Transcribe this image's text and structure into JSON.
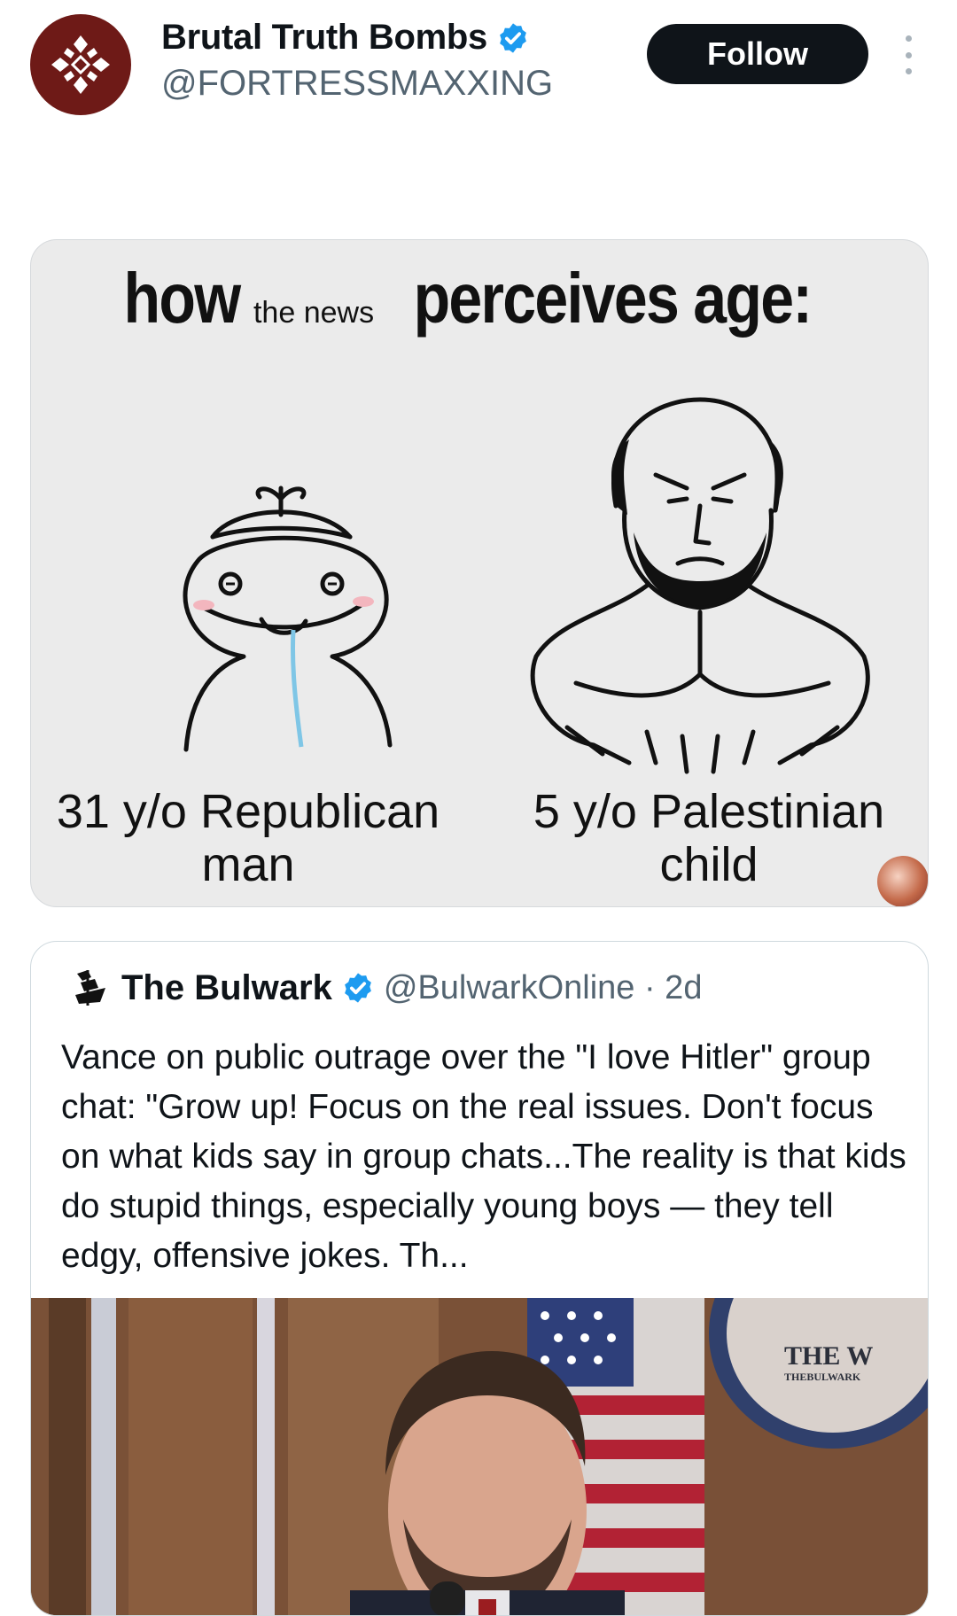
{
  "header": {
    "display_name": "Brutal Truth Bombs",
    "handle": "@FORTRESSMAXXING",
    "follow_label": "Follow"
  },
  "meme": {
    "title_how": "how",
    "title_the_news": "the news",
    "title_perceives": "perceives age:",
    "caption_left": "31 y/o Republican man",
    "caption_right": "5 y/o Palestinian child"
  },
  "quoted_post": {
    "author_name": "The Bulwark",
    "author_handle": "@BulwarkOnline · 2d",
    "text": "Vance on public outrage over the \"I love Hitler\" group chat: \"Grow up! Focus on the real issues. Don't focus on what kids say in group chats...The reality is that kids do stupid things, especially young boys — they tell edgy, offensive jokes. Th...",
    "media_watermark_line1": "THE W",
    "media_watermark_line2": "THEBULWARK"
  },
  "colors": {
    "avatar_bg": "#6e1a17",
    "verified_blue": "#1d9bf0",
    "follow_bg": "#0f1419",
    "muted_text": "#536471"
  },
  "icons": [
    "org-logo-icon",
    "verified-badge-icon",
    "more-options-icon",
    "bulwark-ship-icon"
  ]
}
